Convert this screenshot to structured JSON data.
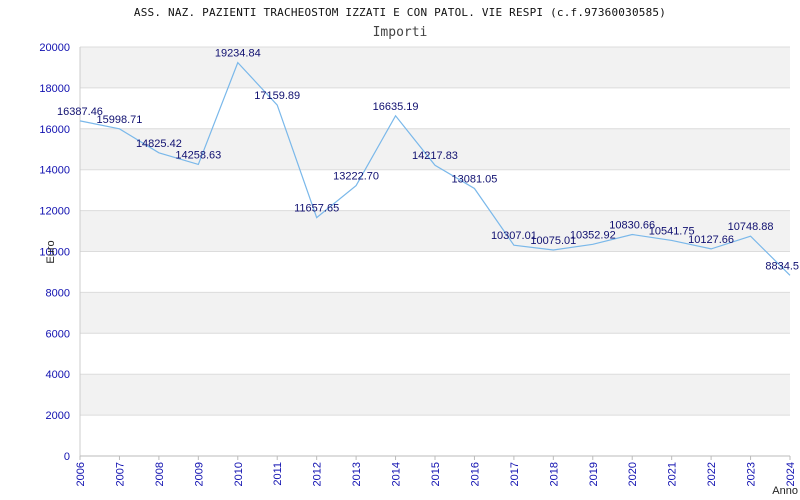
{
  "chart_data": {
    "type": "line",
    "title": "ASS. NAZ. PAZIENTI TRACHEOSTOM IZZATI E CON PATOL. VIE RESPI (c.f.97360030585)",
    "subtitle": "Importi",
    "xlabel": "Anno",
    "ylabel": "Euro",
    "x": [
      "2006",
      "2007",
      "2008",
      "2009",
      "2010",
      "2011",
      "2012",
      "2013",
      "2014",
      "2015",
      "2016",
      "2017",
      "2018",
      "2019",
      "2020",
      "2021",
      "2022",
      "2023",
      "2024"
    ],
    "values": [
      16387.46,
      15998.71,
      14825.42,
      14258.63,
      19234.84,
      17159.89,
      11657.65,
      13222.7,
      16635.19,
      14217.83,
      13081.05,
      10307.01,
      10075.01,
      10352.92,
      10830.66,
      10541.75,
      10127.66,
      10748.88,
      8834.5
    ],
    "data_labels": [
      "16387.46",
      "15998.71",
      "14825.42",
      "14258.63",
      "19234.84",
      "17159.89",
      "11657.65",
      "13222.70",
      "16635.19",
      "14217.83",
      "13081.05",
      "10307.01",
      "10075.01",
      "10352.92",
      "10830.66",
      "10541.75",
      "10127.66",
      "10748.88",
      "8834.5"
    ],
    "ylim": [
      0,
      20000
    ],
    "yticks": [
      "0",
      "2000",
      "4000",
      "6000",
      "8000",
      "10000",
      "12000",
      "14000",
      "16000",
      "18000",
      "20000"
    ],
    "grid": true,
    "band_colors": [
      "#f2f2f2",
      "#ffffff"
    ],
    "line_color": "#7ab8ea",
    "tick_color": "#1010b0"
  }
}
